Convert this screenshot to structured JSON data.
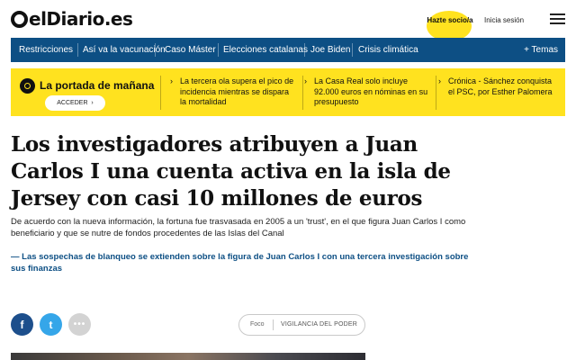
{
  "header": {
    "logo_text": "elDiario.es",
    "socio_label": "Hazte socio/a",
    "login_label": "Inicia sesión",
    "accent_color": "#ffe21f",
    "icons": [
      "logo-circle-icon",
      "hamburger-menu-icon"
    ]
  },
  "nav": {
    "items": [
      {
        "label": "Restricciones"
      },
      {
        "label": "Así va la vacunación"
      },
      {
        "label": "Caso Máster"
      },
      {
        "label": "Elecciones catalanas"
      },
      {
        "label": "Joe Biden"
      },
      {
        "label": "Crisis climática"
      }
    ],
    "temas_label": "+ Temas",
    "bg_color": "#0d4f84"
  },
  "band": {
    "portada_title": "La portada de mañana",
    "acceder_label": "ACCEDER",
    "stories": [
      {
        "text": "La tercera ola supera el pico de incidencia mientras se dispara la mortalidad"
      },
      {
        "text": "La Casa Real solo incluye 92.000 euros en nóminas en su presupuesto"
      },
      {
        "text": "Crónica - Sánchez conquista el PSC, por Esther Palomera"
      }
    ]
  },
  "article": {
    "headline": "Los investigadores atribuyen a Juan Carlos I una cuenta activa en la isla de Jersey con casi 10 millones de euros",
    "summary": "De acuerdo con la nueva información, la fortuna fue trasvasada en 2005 a un 'trust', en el que figura Juan Carlos I como beneficiario y que se nutre de fondos procedentes de las Islas del Canal",
    "related": "— Las sospechas de blanqueo se extienden sobre la figura de Juan Carlos I con una tercera investigación sobre sus finanzas"
  },
  "share": {
    "facebook_glyph": "f",
    "twitter_glyph": "t",
    "more_glyph": "•••"
  },
  "foco": {
    "label": "Foco",
    "topic": "VIGILANCIA DEL PODER"
  }
}
